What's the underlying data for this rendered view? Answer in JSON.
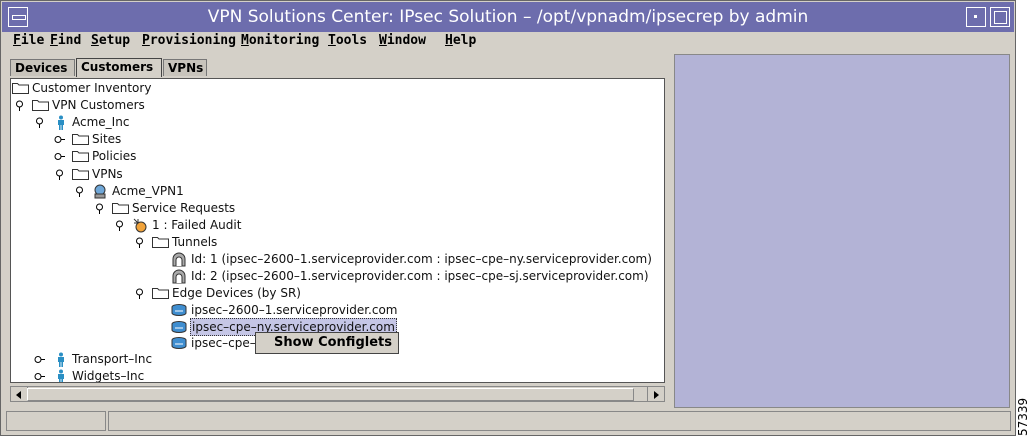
{
  "window": {
    "title": "VPN Solutions Center: IPsec Solution – /opt/vpnadm/ipsecrep by admin"
  },
  "menu": [
    {
      "mnemonic": "F",
      "rest": "ile"
    },
    {
      "mnemonic": "F",
      "rest": "ind",
      "prefix": ""
    },
    {
      "mnemonic": "S",
      "rest": "etup"
    },
    {
      "mnemonic": "P",
      "rest": "rovisioning"
    },
    {
      "mnemonic": "M",
      "rest": "onitoring"
    },
    {
      "mnemonic": "T",
      "rest": "ools"
    },
    {
      "mnemonic": "W",
      "rest": "indow"
    },
    {
      "mnemonic": "H",
      "rest": "elp"
    }
  ],
  "tabs": [
    "Devices",
    "Customers",
    "VPNs"
  ],
  "active_tab": "Customers",
  "tree": {
    "root": "Customer Inventory",
    "vpn_customers": "VPN Customers",
    "acme": "Acme_Inc",
    "sites": "Sites",
    "policies": "Policies",
    "vpns": "VPNs",
    "acme_vpn": "Acme_VPN1",
    "service_requests": "Service Requests",
    "failed_audit": "1 : Failed Audit",
    "tunnels": "Tunnels",
    "tunnel_1": "Id: 1 (ipsec–2600–1.serviceprovider.com : ipsec–cpe–ny.serviceprovider.com)",
    "tunnel_2": "Id: 2 (ipsec–2600–1.serviceprovider.com : ipsec–cpe–sj.serviceprovider.com)",
    "edge_devices": "Edge Devices (by SR)",
    "edge_1": "ipsec–2600–1.serviceprovider.com",
    "edge_2": "ipsec–cpe–ny.serviceprovider.com",
    "edge_3": "ipsec–cpe–",
    "transport": "Transport–Inc",
    "widgets": "Widgets–Inc"
  },
  "context_menu": {
    "item": "Show Configlets"
  },
  "side_label": "57339",
  "colors": {
    "titlebar": "#6d6dad",
    "right_panel": "#b3b3d6",
    "selection": "#c5c6e6"
  }
}
